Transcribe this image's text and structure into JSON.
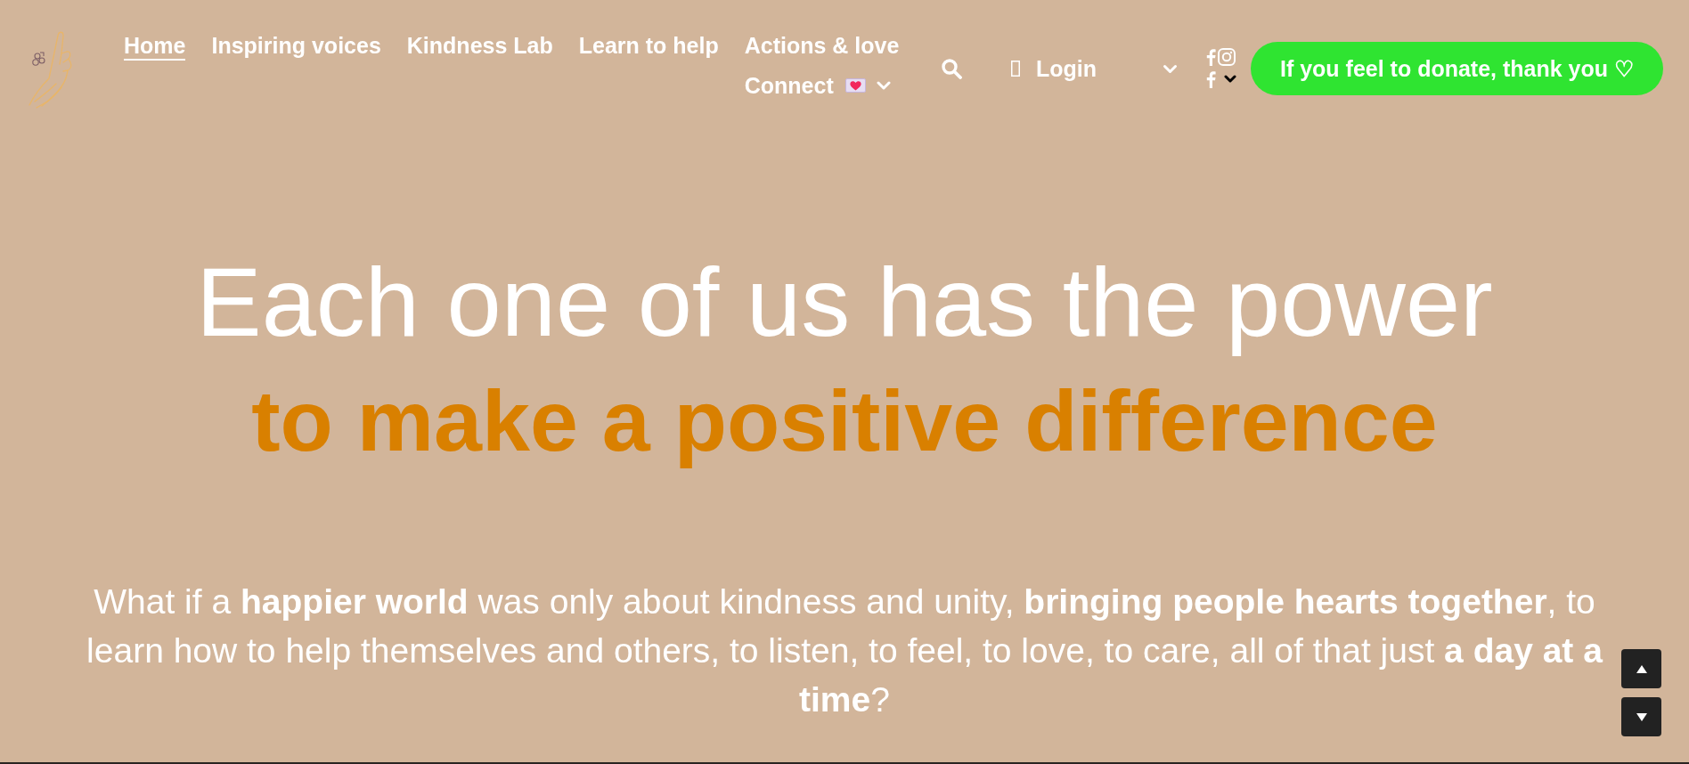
{
  "header": {
    "nav": {
      "items": [
        {
          "label": "Home",
          "selected": true,
          "kind": "link"
        },
        {
          "label": "Inspiring voices",
          "selected": false,
          "kind": "link"
        },
        {
          "label": "Kindness Lab",
          "selected": false,
          "kind": "link"
        },
        {
          "label": "Learn to help",
          "selected": false,
          "kind": "link"
        },
        {
          "label": "Actions & love",
          "selected": false,
          "kind": "link"
        },
        {
          "label": "Connect",
          "selected": false,
          "kind": "dropdown"
        }
      ]
    },
    "login": {
      "label": "Login"
    },
    "donate_button": {
      "label": "If you feel to donate, thank you ♡"
    }
  },
  "hero": {
    "title": "Each one of us has the power",
    "highlight": "to make a positive difference",
    "text": "What if a **happier world** was only about kindness and unity, **bringing people hearts together**, to learn how to help themselves and others, to listen, to feel, to love, to care, all of that just **a day at a time**?"
  }
}
